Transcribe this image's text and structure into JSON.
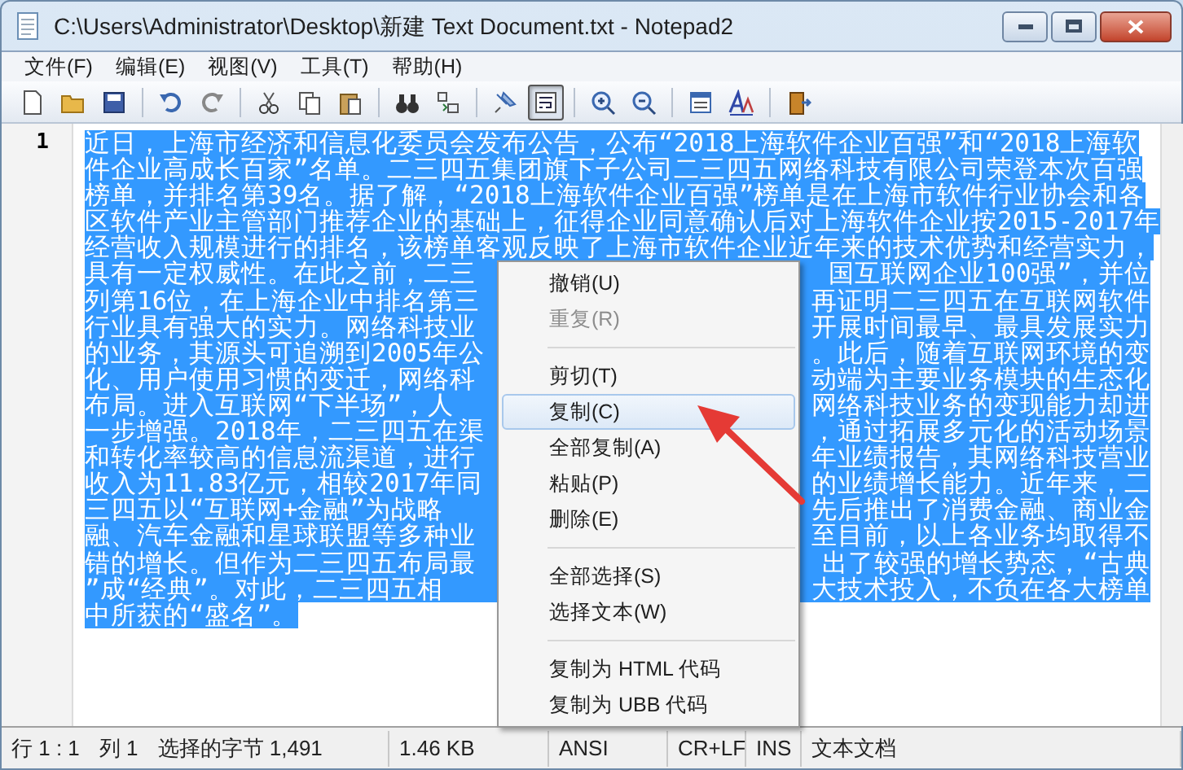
{
  "window": {
    "title": "C:\\Users\\Administrator\\Desktop\\新建 Text Document.txt - Notepad2"
  },
  "menu_bar": [
    "文件(F)",
    "编辑(E)",
    "视图(V)",
    "工具(T)",
    "帮助(H)"
  ],
  "toolbar": [
    {
      "pressed": false
    },
    {
      "pressed": false
    },
    {
      "pressed": false
    },
    {
      "pressed": false
    },
    {
      "pressed": false
    },
    {
      "pressed": false
    },
    {
      "pressed": false
    },
    {
      "pressed": false
    },
    {
      "pressed": false
    },
    {
      "pressed": false
    },
    {
      "pressed": false
    },
    {
      "pressed": true
    },
    {
      "pressed": false
    },
    {
      "pressed": false
    },
    {
      "pressed": false
    },
    {
      "pressed": false
    },
    {
      "pressed": false
    }
  ],
  "editor": {
    "line_number": "1",
    "lines": [
      {
        "text": "近日，上海市经济和信息化委员会发布公告，公布“2018上海软件企业百强”和“2018上海软"
      },
      {
        "text": "件企业高成长百家”名单。二三四五集团旗下子公司二三四五网络科技有限公司荣登本次百强"
      },
      {
        "text": "榜单，并排名第39名。据了解，“2018上海软件企业百强”榜单是在上海市软件行业协会和各"
      },
      {
        "text": "区软件产业主管部门推荐企业的基础上，征得企业同意确认后对上海软件企业按2015-2017年"
      },
      {
        "text": "经营收入规模进行的排名，该榜单客观反映了上海市软件企业近年来的技术优势和经营实力，"
      },
      {
        "left": "具有一定权威性。在此之前，二三",
        "right": "国互联网企业100强”，并位"
      },
      {
        "left": "列第16位，在上海企业中排名第三",
        "right": "再证明二三四五在互联网软件"
      },
      {
        "left": "行业具有强大的实力。网络科技业",
        "right": "开展时间最早、最具发展实力"
      },
      {
        "left": "的业务，其源头可追溯到2005年公",
        "right": "。此后，随着互联网环境的变"
      },
      {
        "left": "化、用户使用习惯的变迁，网络科",
        "right": "动端为主要业务模块的生态化"
      },
      {
        "left": "布局。进入互联网“下半场”，人",
        "right": "网络科技业务的变现能力却进"
      },
      {
        "left": "一步增强。2018年，二三四五在渠",
        "right": "，通过拓展多元化的活动场景"
      },
      {
        "left": "和转化率较高的信息流渠道，进行",
        "right": "年业绩报告，其网络科技营业"
      },
      {
        "left": "收入为11.83亿元，相较2017年同",
        "right": "的业绩增长能力。近年来，二"
      },
      {
        "left": "三四五以“互联网+金融”为战略",
        "right": "先后推出了消费金融、商业金"
      },
      {
        "left": "融、汽车金融和星球联盟等多种业",
        "right": "至目前，以上各业务均取得不"
      },
      {
        "left": "错的增长。但作为二三四五布局最",
        "right": "出了较强的增长势态，“古典"
      },
      {
        "left": "”成“经典”。对此，二三四五相",
        "right": "大技术投入，不负在各大榜单"
      },
      {
        "text": "中所获的“盛名”。"
      }
    ]
  },
  "context_menu": [
    {
      "kind": "item",
      "label": "撤销(U)",
      "disabled": false,
      "selected": false
    },
    {
      "kind": "item",
      "label": "重复(R)",
      "disabled": true,
      "selected": false
    },
    {
      "kind": "separator"
    },
    {
      "kind": "item",
      "label": "剪切(T)",
      "disabled": false,
      "selected": false
    },
    {
      "kind": "item",
      "label": "复制(C)",
      "disabled": false,
      "selected": true
    },
    {
      "kind": "item",
      "label": "全部复制(A)",
      "disabled": false,
      "selected": false
    },
    {
      "kind": "item",
      "label": "粘贴(P)",
      "disabled": false,
      "selected": false
    },
    {
      "kind": "item",
      "label": "删除(E)",
      "disabled": false,
      "selected": false
    },
    {
      "kind": "separator"
    },
    {
      "kind": "item",
      "label": "全部选择(S)",
      "disabled": false,
      "selected": false
    },
    {
      "kind": "item",
      "label": "选择文本(W)",
      "disabled": false,
      "selected": false
    },
    {
      "kind": "separator"
    },
    {
      "kind": "item",
      "label": "复制为 HTML 代码",
      "disabled": false,
      "selected": false
    },
    {
      "kind": "item",
      "label": "复制为 UBB 代码",
      "disabled": false,
      "selected": false
    }
  ],
  "status_bar": [
    [
      "行 1 : 1",
      "列 1",
      "选择的字节 1,491"
    ],
    [
      "1.46 KB"
    ],
    [
      "ANSI"
    ],
    [
      "CR+LF"
    ],
    [
      "INS"
    ],
    [
      "文本文档"
    ]
  ]
}
